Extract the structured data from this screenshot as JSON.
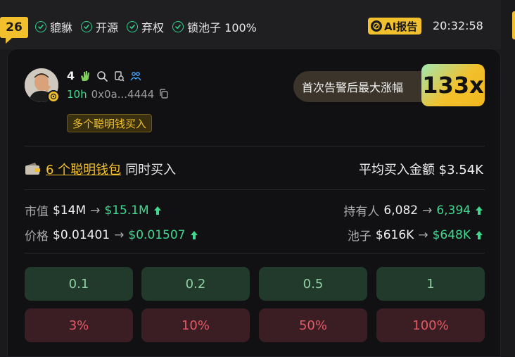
{
  "header": {
    "rank": "26",
    "checks": [
      "貔貅",
      "开源",
      "弃权",
      "锁池子 100%"
    ],
    "ai_report_label": "AI报告",
    "time": "20:32:58"
  },
  "token": {
    "holder_count": "4",
    "age": "10h",
    "address": "0x0a...4444",
    "tag": "多个聪明钱买入",
    "gain_label": "首次告警后最大涨幅",
    "gain_value": "133x"
  },
  "smart_money": {
    "link_text": "6 个聪明钱包",
    "suffix": "同时买入",
    "avg_buy_label": "平均买入金额",
    "avg_buy_value": "$3.54K"
  },
  "stats": {
    "market_cap": {
      "label": "市值",
      "from": "$14M",
      "to": "$15.1M"
    },
    "price": {
      "label": "价格",
      "from": "$0.01401",
      "to": "$0.01507"
    },
    "holders": {
      "label": "持有人",
      "from": "6,082",
      "to": "6,394"
    },
    "pool": {
      "label": "池子",
      "from": "$616K",
      "to": "$648K"
    },
    "arrow": "→"
  },
  "buy_buttons": [
    "0.1",
    "0.2",
    "0.5",
    "1"
  ],
  "sell_buttons": [
    "3%",
    "10%",
    "50%",
    "100%"
  ],
  "colors": {
    "accent": "#f2c02c",
    "positive": "#3fd890",
    "buy_bg": "#223a2c",
    "sell_bg": "#3b1e24",
    "sell_text": "#e45a66"
  }
}
